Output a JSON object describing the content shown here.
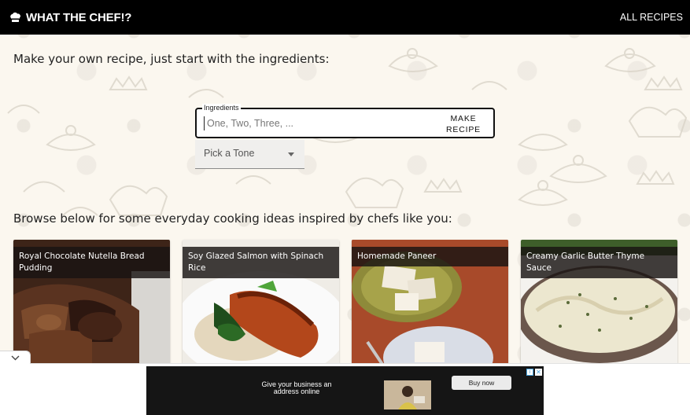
{
  "navbar": {
    "brand": "WHAT THE CHEF!?",
    "brand_icon": "chef-hat-icon",
    "all_recipes": "ALL RECIPES"
  },
  "intro_text": "Make your own recipe, just start with the ingredients:",
  "ingredients": {
    "label": "Ingredients",
    "placeholder": "One, Two, Three, ...",
    "value": ""
  },
  "make_recipe_button": "MAKE RECIPE",
  "tone_select": {
    "placeholder": "Pick a Tone",
    "icon": "caret-down-icon"
  },
  "browse_text": "Browse below for some everyday cooking ideas inspired by chefs like you:",
  "cards": [
    {
      "title": "Royal Chocolate Nutella Bread Pudding"
    },
    {
      "title": "Soy Glazed Salmon with Spinach Rice"
    },
    {
      "title": "Homemade Paneer"
    },
    {
      "title": "Creamy Garlic Butter Thyme Sauce"
    }
  ],
  "ad": {
    "headline": "Give your business an address online",
    "button": "Buy now",
    "info_icon": "ad-info-icon",
    "close_icon": "close-icon"
  },
  "collapse_icon": "chevron-down-icon",
  "colors": {
    "navbar_bg": "#000000",
    "page_bg": "#fbf7ef",
    "card_title_bg": "#191412"
  }
}
